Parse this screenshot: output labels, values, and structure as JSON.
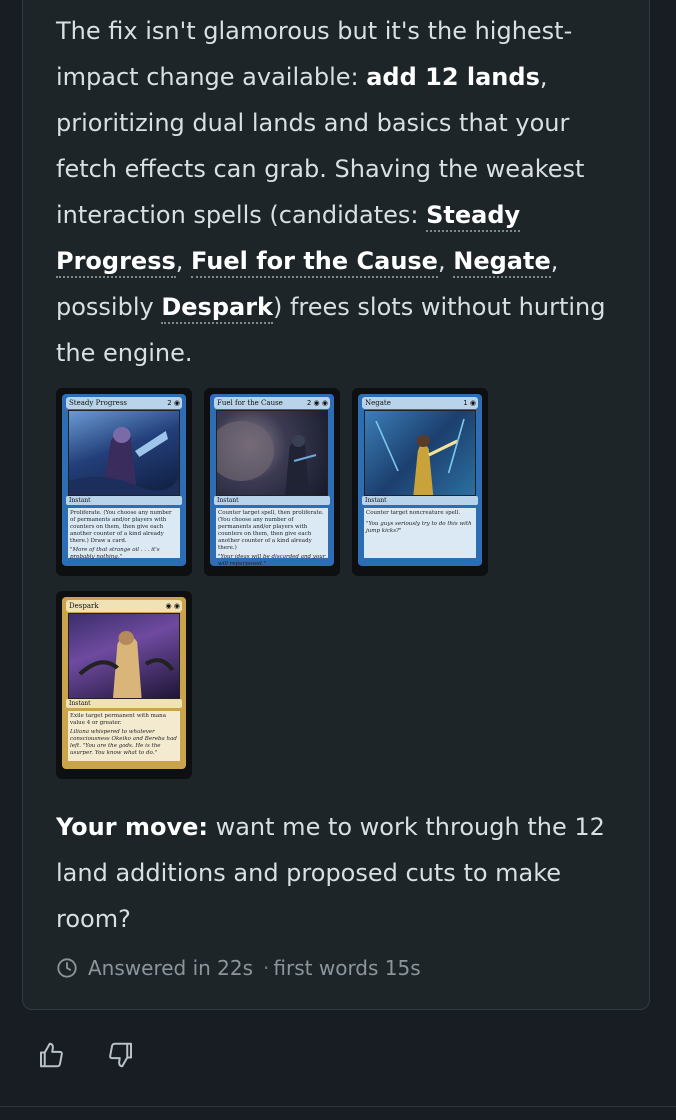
{
  "message": {
    "p1_lead": "The fix isn't glamorous but it's the highest-impact change available: ",
    "p1_bold": "add 12 lands",
    "p1_after": ", prioritizing dual lands and basics that your fetch effects can grab. Shaving the weakest interaction spells (candidates: ",
    "card_link_1": "Steady Progress",
    "sep_1": ", ",
    "card_link_2": "Fuel for the Cause",
    "sep_2": ", ",
    "card_link_3": "Negate",
    "sep_3": ", possibly ",
    "card_link_4": "Despark",
    "p1_end": ") frees slots without hurting the engine.",
    "p2_bold": "Your move:",
    "p2_text": " want me to work through the 12 land additions and proposed cuts to make room?"
  },
  "cards": [
    {
      "name": "Steady Progress",
      "cost": "2 ◉",
      "type": "Instant",
      "text": "Proliferate. (You choose any number of permanents and/or players with counters on them, then give each another counter of a kind already there.) Draw a card.",
      "flavor": "\"More of that strange oil . . . it's probably nothing.\"",
      "color": "blue"
    },
    {
      "name": "Fuel for the Cause",
      "cost": "2 ◉ ◉",
      "type": "Instant",
      "text": "Counter target spell, then proliferate. (You choose any number of permanents and/or players with counters on them, then give each another counter of a kind already there.)",
      "flavor": "\"Your ideas will be discarded and your will repurposed.\"",
      "color": "blue"
    },
    {
      "name": "Negate",
      "cost": "1 ◉",
      "type": "Instant",
      "text": "Counter target noncreature spell.",
      "flavor": "\"You guys seriously try to do this with jump kicks?\"",
      "color": "blue"
    },
    {
      "name": "Despark",
      "cost": "◉ ◉",
      "type": "Instant",
      "text": "Exile target permanent with mana value 4 or greater.",
      "flavor": "Liliana whispered to whatever consciousness Okeiko and Bereba had left. \"You are the gods. He is the usurper. You know what to do.\"",
      "color": "gold"
    }
  ],
  "meta": {
    "answered": "Answered in 22s",
    "separator": "·",
    "first_words": "first words 15s"
  },
  "icons": {
    "clock": "clock-icon",
    "thumbs_up": "thumbs-up-icon",
    "thumbs_down": "thumbs-down-icon"
  }
}
